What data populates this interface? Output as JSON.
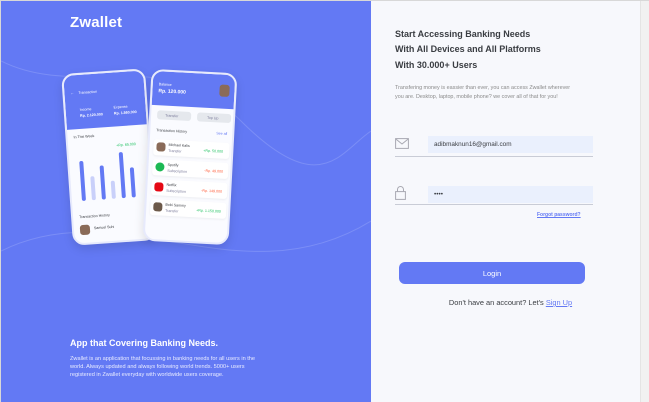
{
  "brand": {
    "name": "Zwallet"
  },
  "hero": {
    "title": "App that Covering Banking Needs.",
    "description": "Zwallet is an application that focussing in banking needs for all users in the world. Always updated and always following world trends. 5000+ users registered in Zwallet everyday with worldwide users coverage."
  },
  "mockup": {
    "phone1": {
      "header": "Transaction",
      "income_label": "Income",
      "income_value": "Rp. 2.120.000",
      "expense_label": "Expense",
      "expense_value": "Rp. 1.560.000",
      "week_label": "In This Week",
      "badge": "+Rp. 65.000",
      "history_label": "Transaction History",
      "history_name": "Samuel Suhi"
    },
    "phone2": {
      "balance_label": "Balance",
      "balance": "Rp. 120.000",
      "transfer": "Transfer",
      "topup": "Top Up",
      "history_label": "Transaction History",
      "see_all": "See all",
      "items": [
        {
          "name": "Michael Kalis",
          "type": "Transfer",
          "amount": "+Rp. 50.000"
        },
        {
          "name": "Spotify",
          "type": "Subscription",
          "amount": "-Rp. 49.000"
        },
        {
          "name": "Netflix",
          "type": "Subscription",
          "amount": "-Rp. 149.000"
        },
        {
          "name": "Bobi Sammy",
          "type": "Transfer",
          "amount": "+Rp. 1.150.000"
        }
      ]
    }
  },
  "form": {
    "title_line1": "Start Accessing Banking Needs",
    "title_line2": "With All Devices and All Platforms",
    "title_line3": "With 30.000+ Users",
    "description": "Transfering money is eassier than ever, you can access Zwallet wherever you are. Desktop, laptop, mobile phone? we cover all of that for you!",
    "email_value": "adibmaknun16@gmail.com",
    "password_value": "••••",
    "forgot_label": "Forgot password?",
    "login_label": "Login",
    "signup_prompt": "Don't have an account? Let's ",
    "signup_link": "Sign Up"
  },
  "colors": {
    "primary": "#6379F4",
    "input_bg": "#EAF0FD",
    "text": "#3A3D42"
  },
  "icons": [
    "mail-icon",
    "lock-icon"
  ]
}
